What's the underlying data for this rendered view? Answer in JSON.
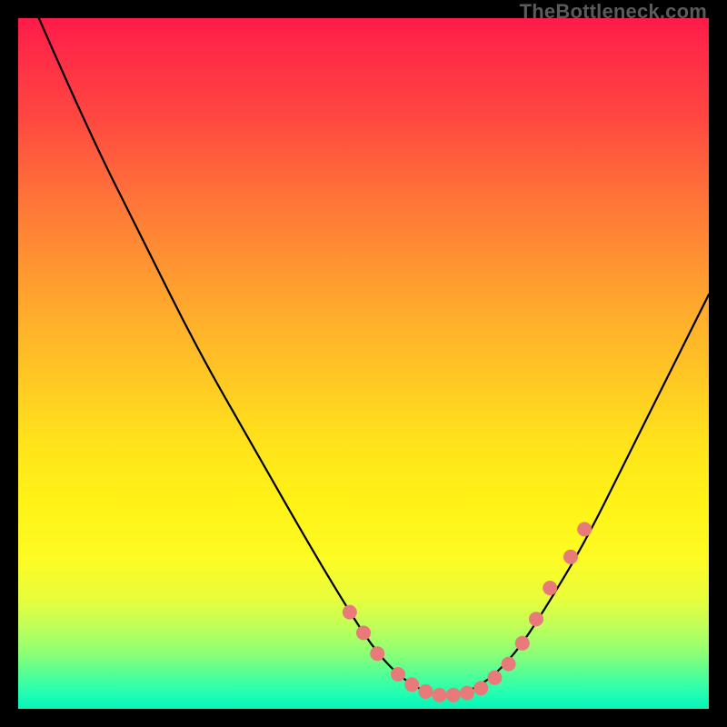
{
  "watermark": {
    "text": "TheBottleneck.com"
  },
  "chart_data": {
    "type": "line",
    "title": "",
    "xlabel": "",
    "ylabel": "",
    "xlim": [
      0,
      100
    ],
    "ylim": [
      0,
      100
    ],
    "series": [
      {
        "name": "bottleneck-curve",
        "x": [
          3,
          10,
          18,
          26,
          34,
          42,
          48,
          52,
          56,
          60,
          64,
          68,
          72,
          76,
          82,
          88,
          94,
          100
        ],
        "y": [
          100,
          84,
          68,
          52,
          38,
          24,
          14,
          8,
          4,
          2,
          2,
          4,
          8,
          14,
          24,
          36,
          48,
          60
        ]
      }
    ],
    "markers": {
      "name": "highlight-dots",
      "color": "#e87b7a",
      "points_x": [
        48,
        50,
        52,
        55,
        57,
        59,
        61,
        63,
        65,
        67,
        69,
        71,
        73,
        75,
        77,
        80,
        82
      ],
      "points_y": [
        14,
        11,
        8,
        5,
        3.5,
        2.5,
        2,
        2,
        2.3,
        3,
        4.5,
        6.5,
        9.5,
        13,
        17.5,
        22,
        26
      ]
    }
  }
}
